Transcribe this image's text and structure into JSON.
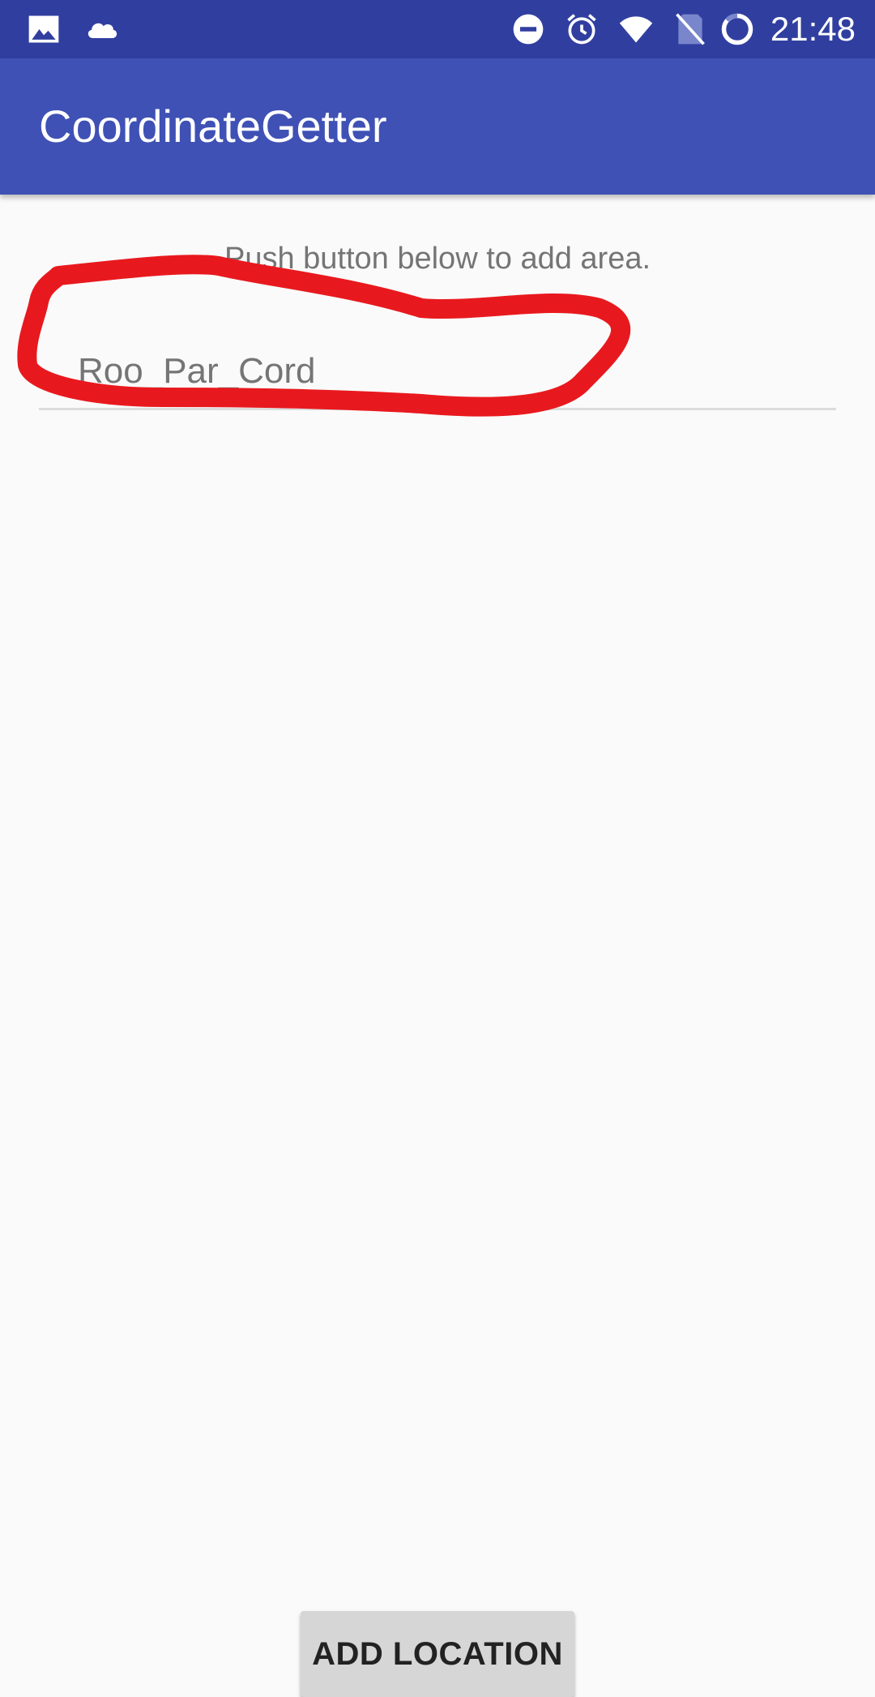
{
  "status_bar": {
    "time": "21:48",
    "icons": [
      "image-icon",
      "cloud-icon",
      "do-not-disturb-icon",
      "alarm-icon",
      "wifi-icon",
      "no-sim-icon",
      "battery-icon"
    ],
    "background": "#303f9f"
  },
  "app_bar": {
    "title": "CoordinateGetter",
    "background": "#3f51b5"
  },
  "main": {
    "hint": "Push button below to add area.",
    "name_field": {
      "value": "Roo_Par_Cord"
    },
    "add_button_label": "ADD LOCATION"
  },
  "annotation": {
    "type": "hand-drawn circle",
    "color": "#e8191e"
  }
}
